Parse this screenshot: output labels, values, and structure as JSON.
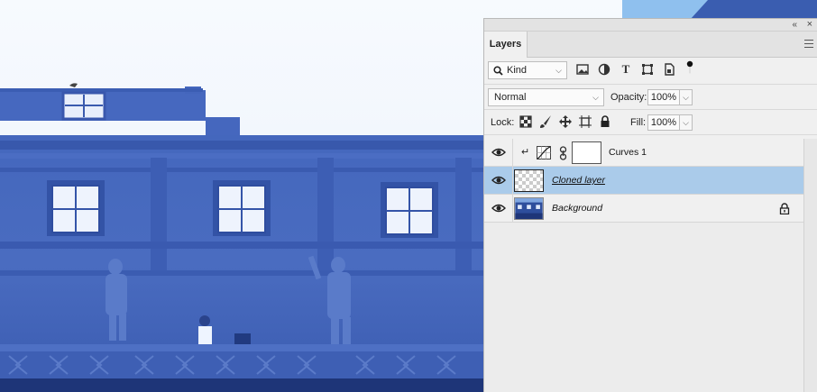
{
  "panel": {
    "tab_label": "Layers",
    "collapse_glyph": "«",
    "close_glyph": "×",
    "filter": {
      "kind_label": "Kind",
      "icon_names": [
        "image-filter-icon",
        "adjustment-filter-icon",
        "type-filter-icon",
        "shape-filter-icon",
        "smart-object-filter-icon",
        "filter-toggle-icon"
      ]
    },
    "blend_mode": "Normal",
    "opacity_label": "Opacity:",
    "opacity_value": "100%",
    "lock_label": "Lock:",
    "fill_label": "Fill:",
    "fill_value": "100%",
    "type_glyph": "T"
  },
  "layers": [
    {
      "name": "Curves 1",
      "selected": false,
      "type": "adjustment",
      "clipped": true
    },
    {
      "name": "Cloned layer",
      "selected": true,
      "type": "transparent"
    },
    {
      "name": "Background",
      "selected": false,
      "type": "image",
      "locked": true
    }
  ],
  "colors": {
    "selection": "#aacbea",
    "panel_bg": "#f0f0f0",
    "sky": "#f4f8fd",
    "building": "#3f62b8"
  }
}
